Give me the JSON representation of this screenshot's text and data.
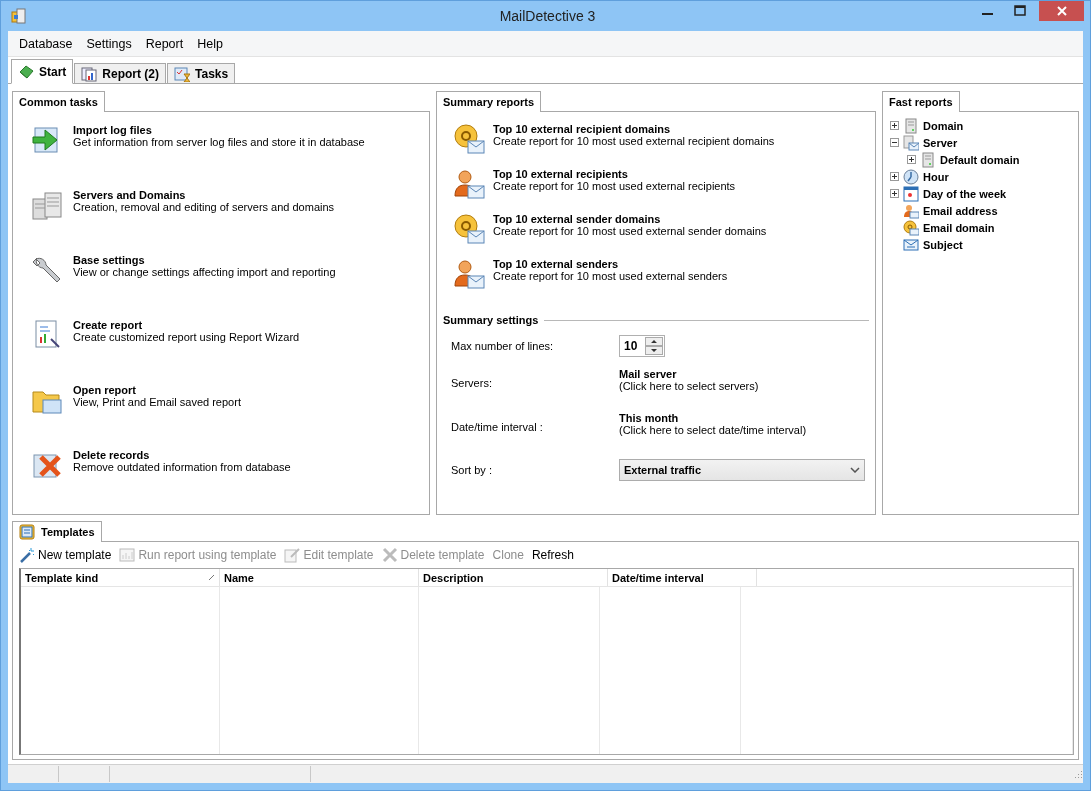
{
  "window": {
    "title": "MailDetective 3"
  },
  "menu": [
    "Database",
    "Settings",
    "Report",
    "Help"
  ],
  "tabs": [
    {
      "label": "Start",
      "selected": true
    },
    {
      "label": "Report (2)",
      "selected": false
    },
    {
      "label": "Tasks",
      "selected": false
    }
  ],
  "common_tasks": {
    "title": "Common tasks",
    "items": [
      {
        "title": "Import log files",
        "description": "Get information from server log files and store it in database"
      },
      {
        "title": "Servers and Domains",
        "description": "Creation, removal and editing of servers and domains"
      },
      {
        "title": "Base settings",
        "description": "View or change settings affecting import and reporting"
      },
      {
        "title": "Create report",
        "description": "Create customized report using Report Wizard"
      },
      {
        "title": "Open report",
        "description": "View, Print and Email saved report"
      },
      {
        "title": "Delete records",
        "description": "Remove outdated information from database"
      }
    ]
  },
  "summary_reports": {
    "title": "Summary reports",
    "items": [
      {
        "title": "Top 10 external recipient domains",
        "description": "Create report for 10 most used external recipient domains"
      },
      {
        "title": "Top 10 external recipients",
        "description": "Create report for 10 most used external recipients"
      },
      {
        "title": "Top 10 external sender domains",
        "description": "Create report for 10 most used external sender domains"
      },
      {
        "title": "Top 10 external senders",
        "description": "Create report for 10 most used external senders"
      }
    ],
    "settings": {
      "title": "Summary settings",
      "max_lines": {
        "label": "Max number of lines:",
        "value": "10"
      },
      "servers": {
        "label": "Servers:",
        "value": "Mail server",
        "hint": "(Click here to select servers)"
      },
      "interval": {
        "label": "Date/time interval :",
        "value": "This month",
        "hint": "(Click here to select date/time interval)"
      },
      "sort_by": {
        "label": "Sort by :",
        "value": "External traffic"
      }
    }
  },
  "fast_reports": {
    "title": "Fast reports",
    "tree": [
      {
        "label": "Domain",
        "kind": "branch",
        "expanded": false
      },
      {
        "label": "Server",
        "kind": "branch",
        "expanded": true,
        "children": [
          {
            "label": "Default domain",
            "kind": "branch",
            "expanded": false
          }
        ]
      },
      {
        "label": "Hour",
        "kind": "branch",
        "expanded": false
      },
      {
        "label": "Day of the week",
        "kind": "branch",
        "expanded": false
      },
      {
        "label": "Email address",
        "kind": "leaf"
      },
      {
        "label": "Email domain",
        "kind": "leaf"
      },
      {
        "label": "Subject",
        "kind": "leaf"
      }
    ]
  },
  "templates": {
    "title": "Templates",
    "toolbar": [
      {
        "label": "New template",
        "disabled": false
      },
      {
        "label": "Run report using template",
        "disabled": true
      },
      {
        "label": "Edit template",
        "disabled": true
      },
      {
        "label": "Delete template",
        "disabled": true
      },
      {
        "label": "Clone",
        "disabled": true
      },
      {
        "label": "Refresh",
        "disabled": false
      }
    ],
    "columns": [
      "Template kind",
      "Name",
      "Description",
      "Date/time interval"
    ]
  }
}
